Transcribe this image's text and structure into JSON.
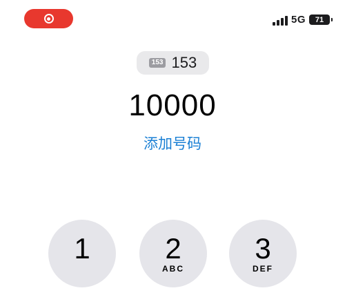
{
  "status_bar": {
    "record_icon": "screen-record-icon",
    "signal_icon": "cellular-signal-icon",
    "network": "5G",
    "battery": "71"
  },
  "sim": {
    "badge": "153",
    "label": "153"
  },
  "dialer": {
    "number": "10000",
    "add_number": "添加号码"
  },
  "keypad": [
    {
      "digit": "1",
      "letters": ""
    },
    {
      "digit": "2",
      "letters": "ABC"
    },
    {
      "digit": "3",
      "letters": "DEF"
    }
  ],
  "colors": {
    "record_red": "#e8382e",
    "link_blue": "#1a7fd4",
    "key_gray": "#e5e5ea"
  }
}
